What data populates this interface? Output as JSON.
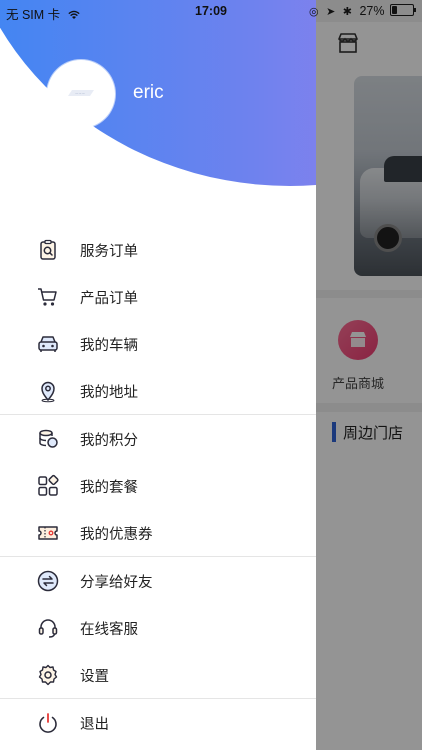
{
  "status_bar": {
    "carrier": "无 SIM 卡",
    "time": "17:09",
    "battery_percent": "27%",
    "battery_level": 0.27
  },
  "profile": {
    "username": "eric"
  },
  "menu_groups": [
    [
      {
        "label": "服务订单",
        "icon": "order-search-icon"
      },
      {
        "label": "产品订单",
        "icon": "cart-icon"
      },
      {
        "label": "我的车辆",
        "icon": "car-icon"
      },
      {
        "label": "我的地址",
        "icon": "location-pin-icon"
      }
    ],
    [
      {
        "label": "我的积分",
        "icon": "coins-icon"
      },
      {
        "label": "我的套餐",
        "icon": "package-grid-icon"
      },
      {
        "label": "我的优惠券",
        "icon": "coupon-icon"
      }
    ],
    [
      {
        "label": "分享给好友",
        "icon": "share-icon"
      },
      {
        "label": "在线客服",
        "icon": "headset-icon"
      },
      {
        "label": "设置",
        "icon": "settings-icon"
      }
    ],
    [
      {
        "label": "退出",
        "icon": "power-icon"
      }
    ]
  ],
  "background_screen": {
    "mall_label": "产品商城",
    "stores_heading": "周边门店"
  },
  "colors": {
    "header_gradient_start": "#3d86f3",
    "header_gradient_end": "#c07de9",
    "accent_blue": "#2f62d6",
    "mall_pink": "#ee3d73",
    "power_red": "#e53935"
  }
}
